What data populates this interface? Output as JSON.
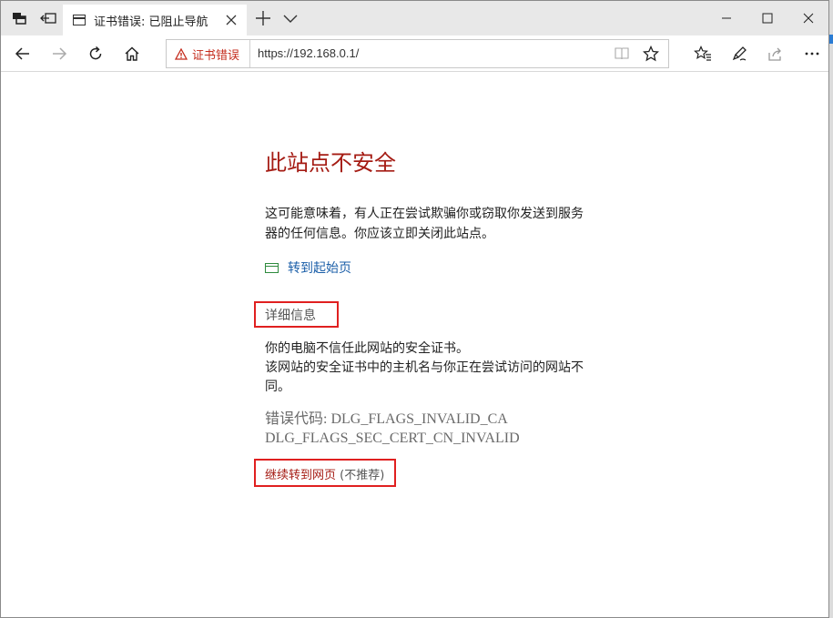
{
  "tab": {
    "title": "证书错误: 已阻止导航"
  },
  "address_bar": {
    "cert_warning": "证书错误",
    "url": "https://192.168.0.1/"
  },
  "error_page": {
    "title": "此站点不安全",
    "description": "这可能意味着，有人正在尝试欺骗你或窃取你发送到服务器的任何信息。你应该立即关闭此站点。",
    "home_link": "转到起始页",
    "details_heading": "详细信息",
    "details_text_1": "你的电脑不信任此网站的安全证书。",
    "details_text_2": "该网站的安全证书中的主机名与你正在尝试访问的网站不同。",
    "error_code_label": "错误代码:",
    "error_code_1": "DLG_FLAGS_INVALID_CA",
    "error_code_2": "DLG_FLAGS_SEC_CERT_CN_INVALID",
    "continue_link": "继续转到网页",
    "not_recommended": "(不推荐)"
  },
  "colors": {
    "error_red": "#a51c14",
    "link_blue": "#1a5ea8",
    "highlight_box": "#e02020"
  }
}
